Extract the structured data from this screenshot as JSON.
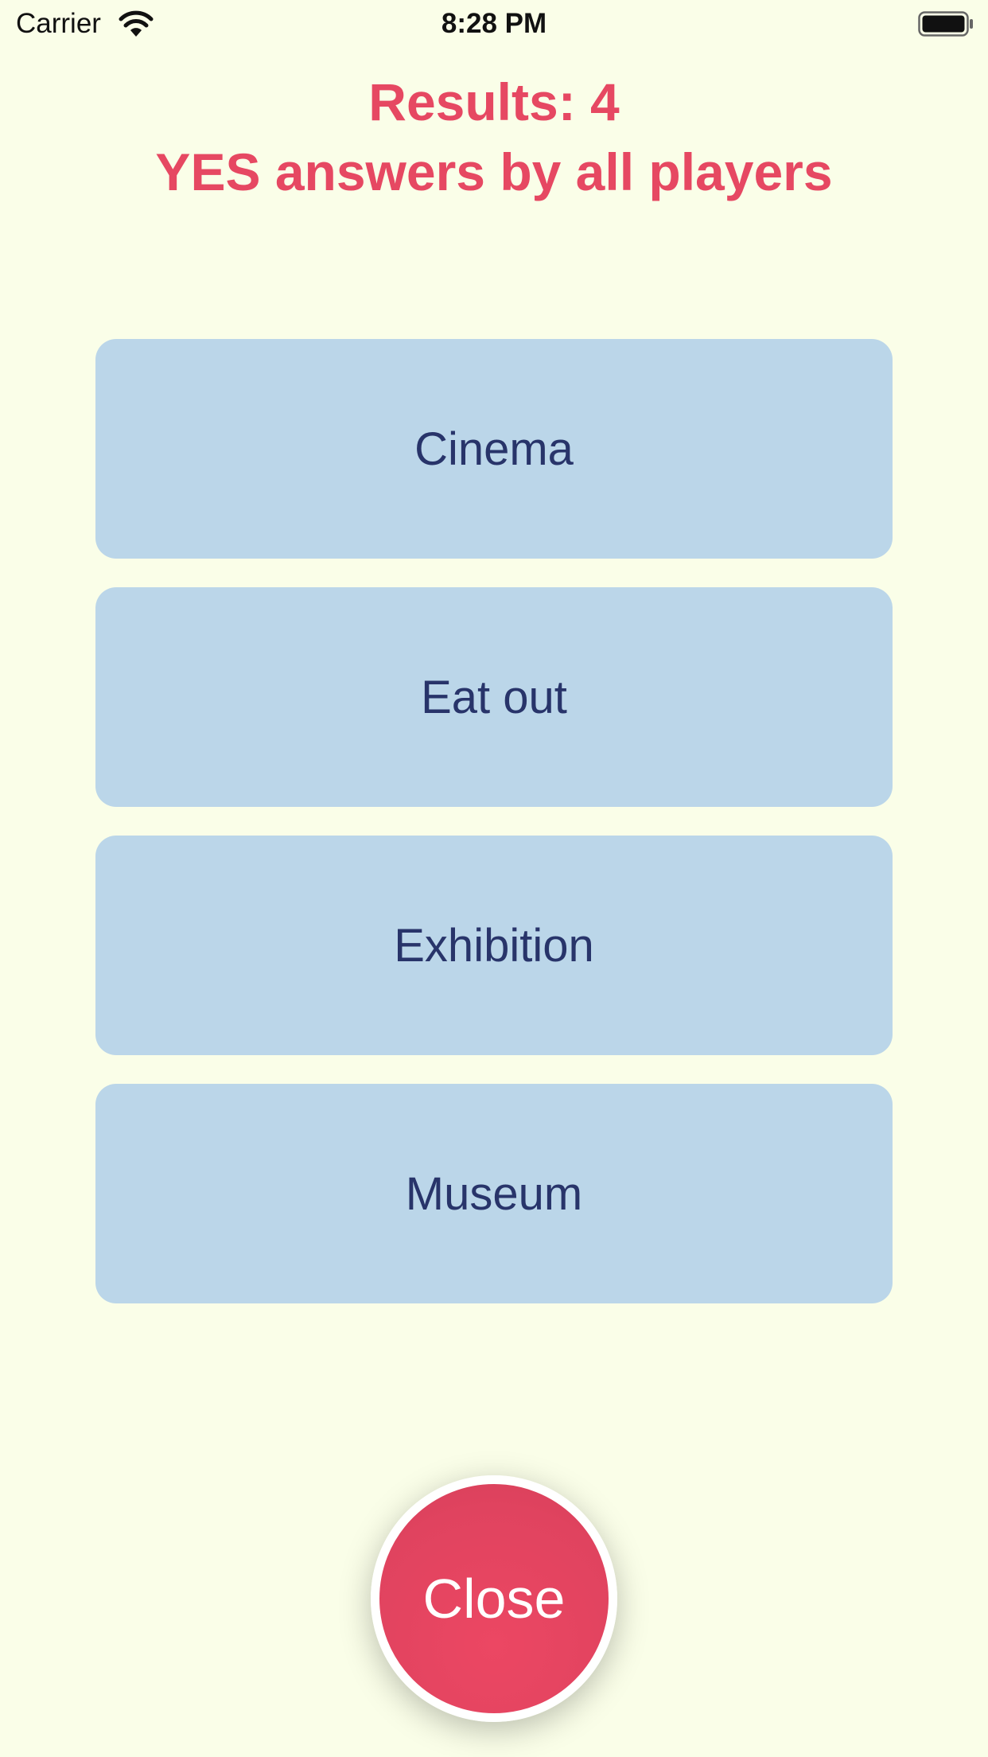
{
  "status_bar": {
    "carrier": "Carrier",
    "time": "8:28 PM",
    "wifi_icon": "wifi-icon",
    "battery_icon": "battery-icon"
  },
  "header": {
    "title_line1": "Results: 4",
    "title_line2": "YES answers by all players",
    "color": "#e64862"
  },
  "results": [
    {
      "label": "Cinema"
    },
    {
      "label": "Eat out"
    },
    {
      "label": "Exhibition"
    },
    {
      "label": "Museum"
    }
  ],
  "close_button": {
    "label": "Close",
    "color": "#e64862"
  },
  "colors": {
    "background": "#fafee8",
    "card_background": "#bbd6e9",
    "card_text": "#28346a"
  }
}
